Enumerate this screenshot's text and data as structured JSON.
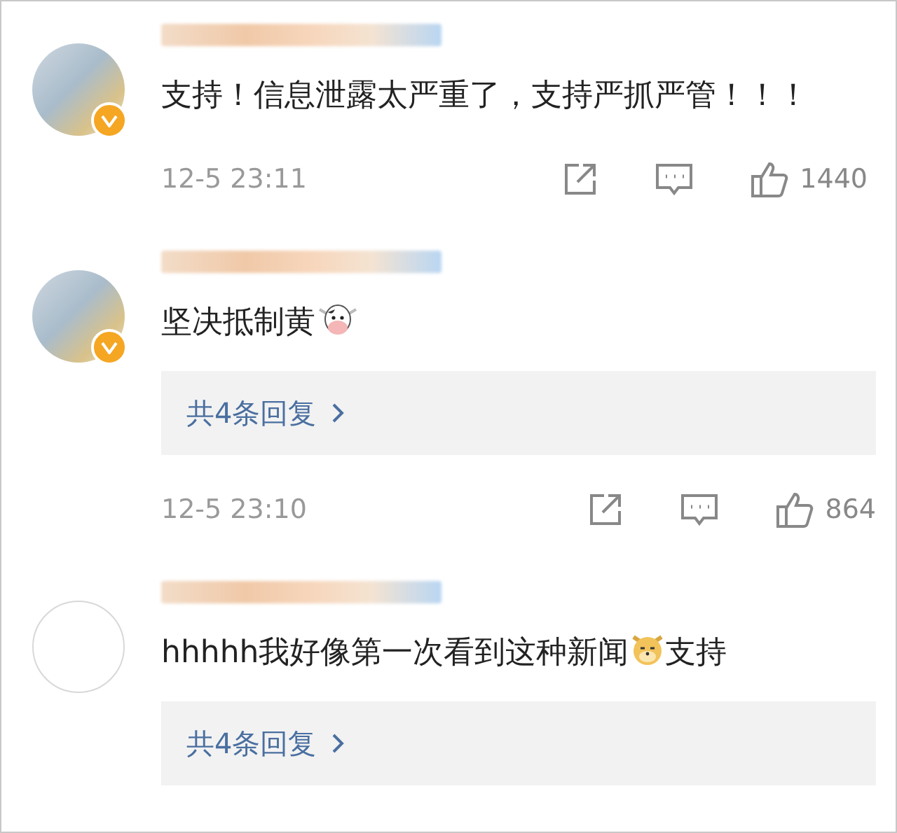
{
  "comments": [
    {
      "avatar": {
        "kind": "photo"
      },
      "verified": true,
      "segments": [
        {
          "kind": "text",
          "text": "支持！信息泄露太严重了，支持严抓严管！！！"
        }
      ],
      "date": "12-5 23:11",
      "likes": "1440"
    },
    {
      "avatar": {
        "kind": "photo"
      },
      "verified": true,
      "segments": [
        {
          "kind": "text",
          "text": "坚决抵制黄"
        },
        {
          "kind": "cow_emoji"
        }
      ],
      "replies": "共4条回复",
      "date": "12-5 23:10",
      "likes": "864"
    },
    {
      "avatar": {
        "kind": "blank"
      },
      "verified": false,
      "segments": [
        {
          "kind": "text",
          "text": "hhhhh我好像第一次看到这种新闻"
        },
        {
          "kind": "dog_emoji"
        },
        {
          "kind": "text",
          "text": "支持"
        }
      ],
      "replies": "共4条回复"
    }
  ]
}
